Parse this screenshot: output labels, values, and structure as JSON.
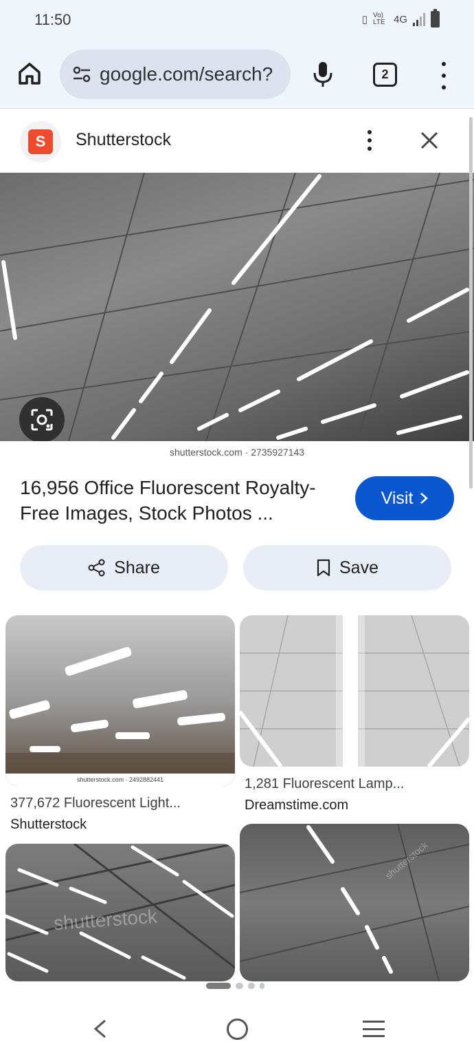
{
  "status_bar": {
    "time": "11:50",
    "network": "4G",
    "volte": "Vo) LTE"
  },
  "toolbar": {
    "url": "google.com/search?",
    "tab_count": "2",
    "home_icon": "home-icon",
    "mic_icon": "mic-icon",
    "menu_icon": "more-vert-icon"
  },
  "source": {
    "name": "Shutterstock",
    "logo_letter": "S",
    "brand_color": "#ee4a2d"
  },
  "main_image": {
    "caption": "shutterstock.com · 2735927143"
  },
  "result": {
    "title": "16,956 Office Fluorescent Royalty-Free Images, Stock Photos ...",
    "visit_label": "Visit",
    "accent": "#0b57d0"
  },
  "actions": {
    "share_label": "Share",
    "save_label": "Save"
  },
  "related": [
    {
      "title": "377,672 Fluorescent Light...",
      "source": "Shutterstock",
      "caption": "shutterstock.com · 2492882441"
    },
    {
      "title": "1,281 Fluorescent Lamp...",
      "source": "Dreamstime.com"
    },
    {
      "watermark": "shutterstock"
    },
    {
      "watermark": "shutterstock"
    }
  ]
}
